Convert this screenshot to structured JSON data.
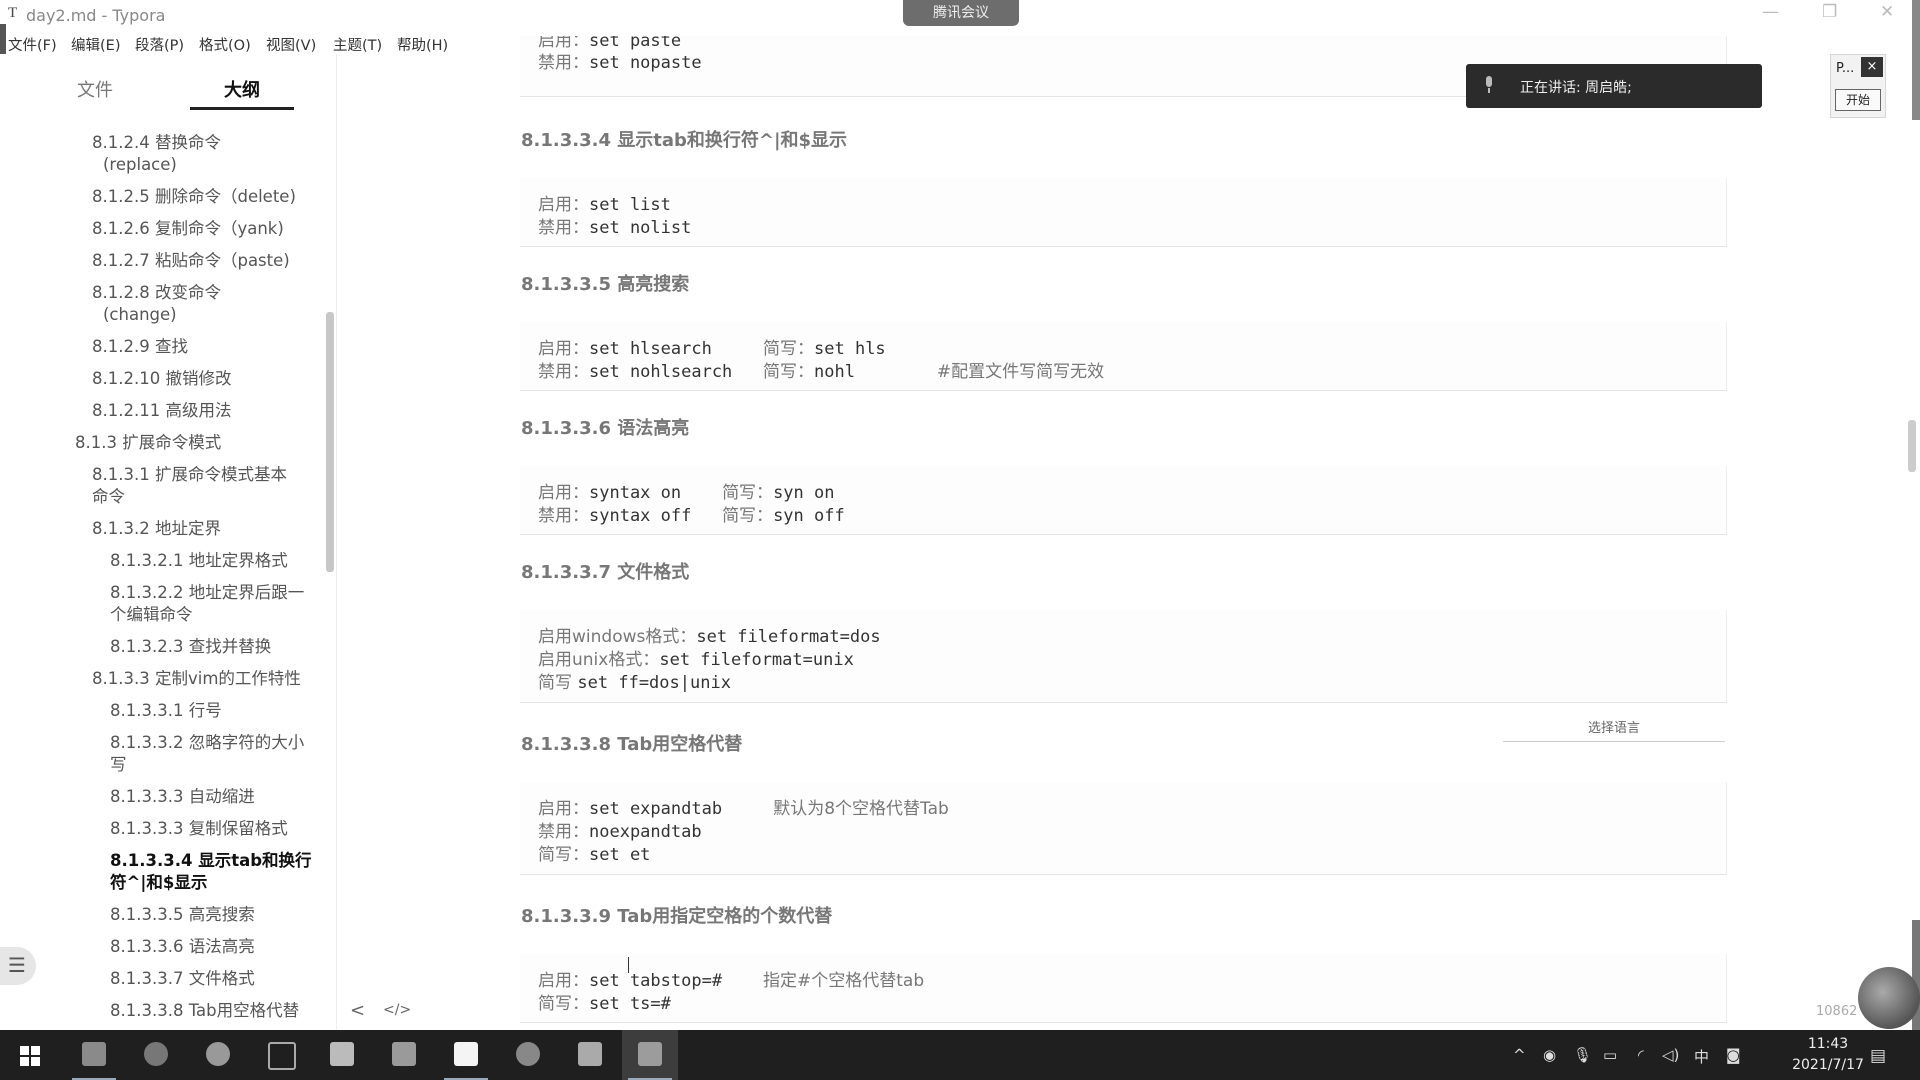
{
  "window": {
    "app_icon": "T",
    "title": "day2.md - Typora",
    "meeting_tab": "腾讯会议"
  },
  "menu": [
    "文件(F)",
    "编辑(E)",
    "段落(P)",
    "格式(O)",
    "视图(V)",
    "主题(T)",
    "帮助(H)"
  ],
  "sidebar": {
    "tab_files": "文件",
    "tab_outline": "大纲",
    "active_tab": "大纲",
    "outline": [
      "8.1.2.4 替换命令",
      "(replace)",
      "8.1.2.5 删除命令（delete)",
      "8.1.2.6 复制命令（yank)",
      "8.1.2.7 粘贴命令（paste)",
      "8.1.2.8 改变命令",
      "(change)",
      "8.1.2.9 查找",
      "8.1.2.10 撤销修改",
      "8.1.2.11 高级用法",
      "8.1.3 扩展命令模式",
      "8.1.3.1 扩展命令模式基本",
      "命令",
      "8.1.3.2 地址定界",
      "8.1.3.2.1 地址定界格式",
      "8.1.3.2.2 地址定界后跟一",
      "个编辑命令",
      "8.1.3.2.3 查找并替换",
      "8.1.3.3 定制vim的工作特性",
      "8.1.3.3.1 行号",
      "8.1.3.3.2 忽略字符的大小",
      "写",
      "8.1.3.3.3 自动缩进",
      "8.1.3.3.3 复制保留格式",
      "8.1.3.3.4 显示tab和换行",
      "符^|和$显示",
      "8.1.3.3.5 高亮搜索",
      "8.1.3.3.6 语法高亮",
      "8.1.3.3.7 文件格式",
      "8.1.3.3.8 Tab用空格代替"
    ],
    "active_item": "8.1.3.3.4 显示tab和换行符^|和$显示",
    "footer_left": "<",
    "footer_code": "</>"
  },
  "content": {
    "top_block": {
      "l1_cn": "启用：",
      "l1_code": "set paste",
      "l2_cn": "禁用：",
      "l2_code": "set nopaste"
    },
    "h4": "8.1.3.3.4 显示tab和换行符^|和$显示",
    "b4": {
      "l1_cn": "启用：",
      "l1_code": "set list",
      "l2_cn": "禁用：",
      "l2_code": "set nolist"
    },
    "h5": "8.1.3.3.5 高亮搜索",
    "b5": {
      "l1_cn": "启用：",
      "l1_code": "set hlsearch   ",
      "l1_cn2": "简写：",
      "l1_code2": "set hls",
      "l2_cn": "禁用：",
      "l2_code": "set nohlsearch ",
      "l2_cn2": "简写：",
      "l2_code2": "nohl      ",
      "l2_comment": "#配置文件写简写无效"
    },
    "h6": "8.1.3.3.6 语法高亮",
    "b6": {
      "l1_cn": "启用：",
      "l1_code": "syntax on    ",
      "l1_cn2": "简写：",
      "l1_code2": "syn on",
      "l2_cn": "禁用：",
      "l2_code": "syntax off   ",
      "l2_cn2": "简写：",
      "l2_code2": "syn off"
    },
    "h7": "8.1.3.3.7 文件格式",
    "b7": {
      "l1_cn": "启用windows格式：",
      "l1_code": "set fileformat=dos",
      "l2_cn": "启用unix格式：",
      "l2_code": "set fileformat=unix",
      "l3_cn": "简写 ",
      "l3_code": "set ff=dos|unix"
    },
    "h8": "8.1.3.3.8 Tab用空格代替",
    "lang_select": "选择语言",
    "b8": {
      "l1_cn": "启用：",
      "l1_code": "set expandtab     ",
      "l1_comment": "默认为8个空格代替Tab",
      "l2_cn": "禁用：",
      "l2_code": "noexpandtab",
      "l3_cn": "简写：",
      "l3_code": "set et"
    },
    "h9": "8.1.3.3.9 Tab用指定空格的个数代替",
    "b9": {
      "l1_cn": "启用：",
      "l1_code": "set tabstop=#    ",
      "l1_comment": "指定#个空格代替tab",
      "l2_cn": "简写：",
      "l2_code": "set ts=#"
    },
    "word_count": "10862"
  },
  "overlay": {
    "speaking_label": "正在讲话: 周启皓;",
    "mini_panel_title": "P...",
    "mini_close": "×",
    "mini_start": "开始"
  },
  "taskbar": {
    "apps": [
      "photo-viewer-icon",
      "obs-icon",
      "wechat-icon",
      "multitask-icon",
      "cloud-icon",
      "file-manager-icon",
      "typora-icon",
      "app-swirl-icon",
      "notes-icon",
      "screen-recorder-icon"
    ],
    "tray_ime": "中",
    "time": "11:43",
    "date": "2021/7/17"
  }
}
